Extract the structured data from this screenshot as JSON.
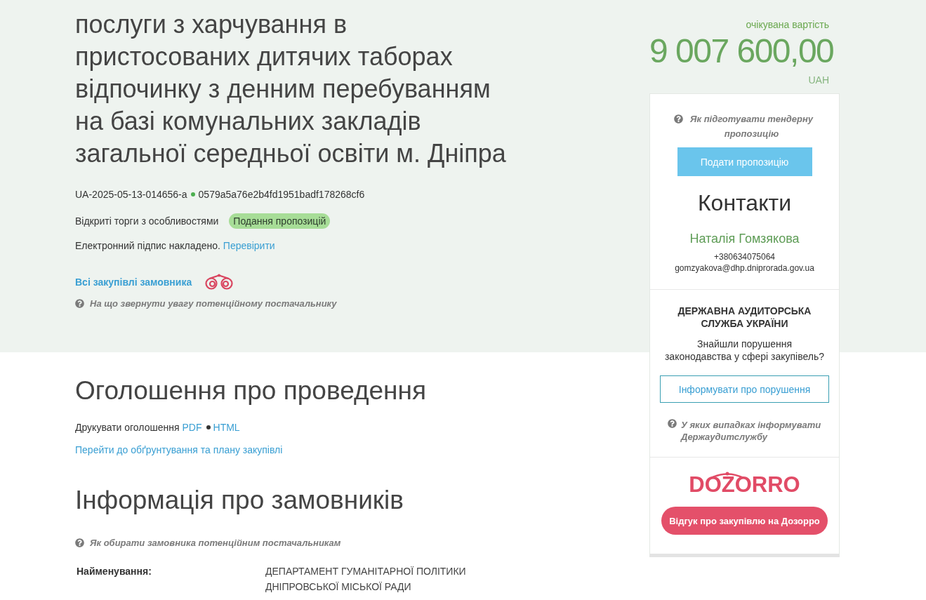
{
  "tender": {
    "title": "послуги з харчування в пристосованих дитячих таборах відпочинку з денним перебуванням на базі комунальних закладів загальної середньої освіти м. Дніпра",
    "tender_id": "UA-2025-05-13-014656-a",
    "hash": "0579a5a76e2b4fd1951badf178268cf6",
    "procedure_type": "Відкриті торги з особливостями",
    "status": "Подання пропозицій",
    "signature_text": "Електронний підпис накладено.",
    "signature_link": "Перевірити",
    "buyer_tenders_link": "Всі закупівлі замовника",
    "supplier_help": "На що звернути увагу потенційному постачальнику"
  },
  "announcement": {
    "heading": "Оголошення про проведення",
    "print_label": "Друкувати оголошення",
    "print_formats": [
      "PDF",
      "HTML"
    ],
    "plan_link": "Перейти до обґрунтування та плану закупівлі"
  },
  "buyers": {
    "heading": "Інформація про замовників",
    "help": "Як обирати замовника потенційним постачальникам",
    "fields": [
      {
        "label": "Найменування:",
        "value": "ДЕПАРТАМЕНТ ГУМАНІТАРНОЇ ПОЛІТИКИ ДНІПРОВСЬКОЇ МІСЬКОЇ РАДИ"
      }
    ]
  },
  "sidebar": {
    "value_label": "очікувана вартість",
    "amount": "9 007 600,00",
    "currency": "UAH",
    "bid_help": "Як підготувати тендерну пропозицію",
    "bid_button": "Подати пропозицію",
    "contacts": {
      "heading": "Контакти",
      "name": "Наталія Гомзякова",
      "phone": "+380634075064",
      "email": "gomzyakova@dhp.dniprorada.gov.ua"
    },
    "audit": {
      "title": "ДЕРЖАВНА АУДИТОРСЬКА СЛУЖБА УКРАЇНИ",
      "question": "Знайшли порушення законодавства у сфері закупівель?",
      "button": "Інформувати про порушення",
      "help": "У яких випадках інформувати Держаудитслужбу"
    },
    "dozorro": {
      "logo": "DOZORRO",
      "button": "Відгук про закупівлю на Дозорро"
    }
  }
}
